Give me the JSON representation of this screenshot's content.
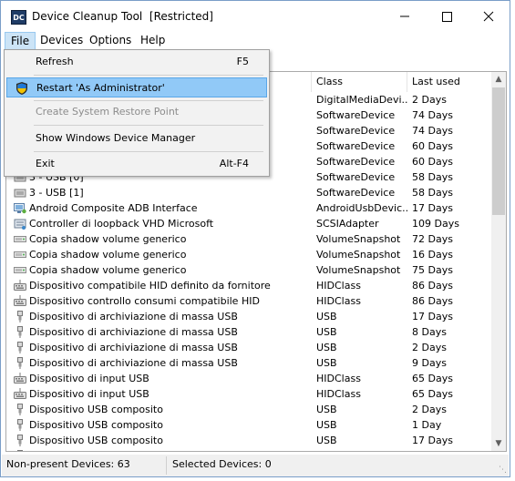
{
  "window": {
    "title": "Device Cleanup Tool  [Restricted]",
    "icon_text": "DC",
    "controls": {
      "minimize": "minimize",
      "maximize": "maximize",
      "close": "close"
    }
  },
  "menubar": {
    "items": [
      "File",
      "Devices",
      "Options",
      "Help"
    ]
  },
  "file_menu": {
    "items": [
      {
        "label": "Refresh",
        "shortcut": "F5",
        "enabled": true,
        "highlighted": false,
        "icon": ""
      },
      {
        "label": "Restart 'As Administrator'",
        "shortcut": "",
        "enabled": true,
        "highlighted": true,
        "icon": "uac-shield-icon"
      },
      {
        "label": "Create System Restore Point",
        "shortcut": "",
        "enabled": false,
        "highlighted": false,
        "icon": ""
      },
      {
        "label": "Show Windows Device Manager",
        "shortcut": "",
        "enabled": true,
        "highlighted": false,
        "icon": ""
      },
      {
        "label": "Exit",
        "shortcut": "Alt-F4",
        "enabled": true,
        "highlighted": false,
        "icon": ""
      }
    ]
  },
  "table": {
    "columns": [
      "Class",
      "Last used"
    ],
    "rows": [
      {
        "name": "",
        "class": "DigitalMediaDevi...",
        "last": "2 Days",
        "icon": "generic-device-icon"
      },
      {
        "name": "",
        "class": "SoftwareDevice",
        "last": "74 Days",
        "icon": "generic-device-icon"
      },
      {
        "name": "",
        "class": "SoftwareDevice",
        "last": "74 Days",
        "icon": "generic-device-icon"
      },
      {
        "name": "",
        "class": "SoftwareDevice",
        "last": "60 Days",
        "icon": "generic-device-icon"
      },
      {
        "name": "",
        "class": "SoftwareDevice",
        "last": "60 Days",
        "icon": "generic-device-icon"
      },
      {
        "name": "3 - USB  [0]",
        "class": "SoftwareDevice",
        "last": "58 Days",
        "icon": "generic-device-icon"
      },
      {
        "name": "3 - USB  [1]",
        "class": "SoftwareDevice",
        "last": "58 Days",
        "icon": "generic-device-icon"
      },
      {
        "name": "Android Composite ADB Interface",
        "class": "AndroidUsbDevic...",
        "last": "17 Days",
        "icon": "android-device-icon"
      },
      {
        "name": "Controller di loopback VHD Microsoft",
        "class": "SCSIAdapter",
        "last": "109 Days",
        "icon": "storage-controller-icon"
      },
      {
        "name": "Copia shadow volume generico",
        "class": "VolumeSnapshot",
        "last": "72 Days",
        "icon": "volume-icon"
      },
      {
        "name": "Copia shadow volume generico",
        "class": "VolumeSnapshot",
        "last": "16 Days",
        "icon": "volume-icon"
      },
      {
        "name": "Copia shadow volume generico",
        "class": "VolumeSnapshot",
        "last": "75 Days",
        "icon": "volume-icon"
      },
      {
        "name": "Dispositivo compatibile HID definito da fornitore",
        "class": "HIDClass",
        "last": "86 Days",
        "icon": "hid-device-icon"
      },
      {
        "name": "Dispositivo controllo consumi compatibile HID",
        "class": "HIDClass",
        "last": "86 Days",
        "icon": "hid-device-icon"
      },
      {
        "name": "Dispositivo di archiviazione di massa USB",
        "class": "USB",
        "last": "17 Days",
        "icon": "usb-plug-icon"
      },
      {
        "name": "Dispositivo di archiviazione di massa USB",
        "class": "USB",
        "last": "8 Days",
        "icon": "usb-plug-icon"
      },
      {
        "name": "Dispositivo di archiviazione di massa USB",
        "class": "USB",
        "last": "2 Days",
        "icon": "usb-plug-icon"
      },
      {
        "name": "Dispositivo di archiviazione di massa USB",
        "class": "USB",
        "last": "9 Days",
        "icon": "usb-plug-icon"
      },
      {
        "name": "Dispositivo di input USB",
        "class": "HIDClass",
        "last": "65 Days",
        "icon": "hid-device-icon"
      },
      {
        "name": "Dispositivo di input USB",
        "class": "HIDClass",
        "last": "65 Days",
        "icon": "hid-device-icon"
      },
      {
        "name": "Dispositivo USB composito",
        "class": "USB",
        "last": "2 Days",
        "icon": "usb-plug-icon"
      },
      {
        "name": "Dispositivo USB composito",
        "class": "USB",
        "last": "1 Day",
        "icon": "usb-plug-icon"
      },
      {
        "name": "Dispositivo USB composito",
        "class": "USB",
        "last": "17 Days",
        "icon": "usb-plug-icon"
      },
      {
        "name": "Dispositivo USB composito",
        "class": "USB",
        "last": "1 Day",
        "icon": "usb-plug-icon"
      }
    ]
  },
  "status": {
    "left": "Non-present Devices: 63",
    "right": "Selected Devices: 0"
  },
  "colors": {
    "menu_highlight": "#91c9f7",
    "menubar_active": "#cce4f7",
    "window_border": "#7a9ec8"
  }
}
